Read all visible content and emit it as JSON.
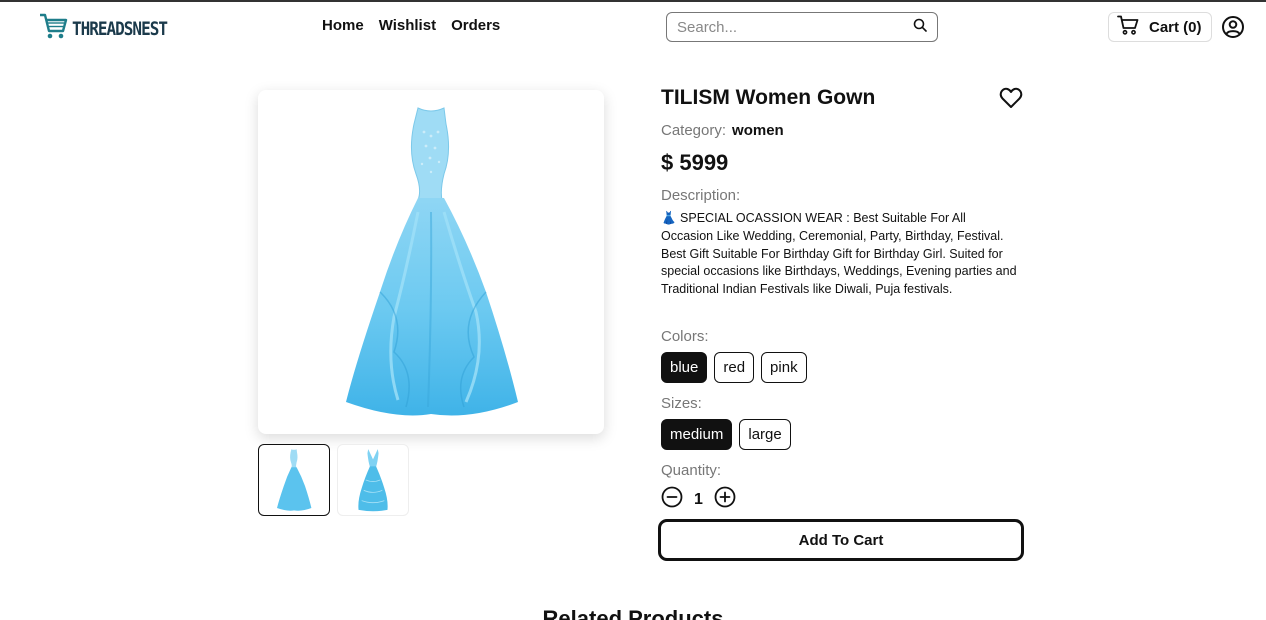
{
  "header": {
    "brand": "THREADSNEST",
    "nav": [
      "Home",
      "Wishlist",
      "Orders"
    ],
    "search_placeholder": "Search...",
    "cart_label": "Cart (0)"
  },
  "product": {
    "title": "TILISM Women Gown",
    "category_label": "Category:",
    "category_value": "women",
    "price": "$ 5999",
    "description_label": "Description:",
    "description": "👗 SPECIAL OCASSION WEAR : Best Suitable For All Occasion Like Wedding, Ceremonial, Party, Birthday, Festival. Best Gift Suitable For Birthday Gift for Birthday Girl. Suited for special occasions like Birthdays, Weddings, Evening parties and Traditional Indian Festivals like Diwali, Puja festivals.",
    "colors_label": "Colors:",
    "colors": [
      "blue",
      "red",
      "pink"
    ],
    "selected_color": "blue",
    "sizes_label": "Sizes:",
    "sizes": [
      "medium",
      "large"
    ],
    "selected_size": "medium",
    "quantity_label": "Quantity:",
    "quantity": "1",
    "add_to_cart": "Add To Cart",
    "dress_color": "#5bc3ee"
  },
  "related_title": "Related Products"
}
